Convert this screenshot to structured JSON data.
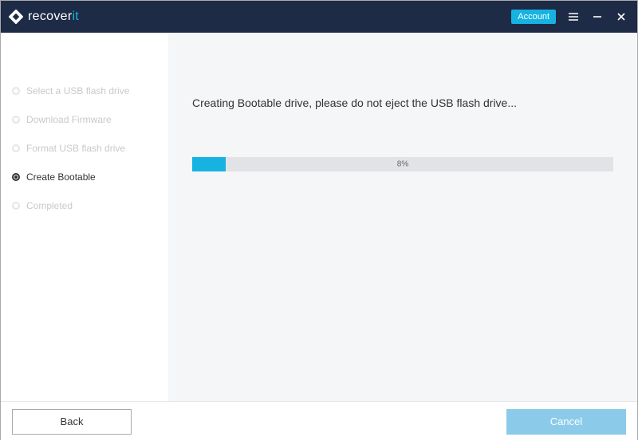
{
  "header": {
    "brand_prefix": "recover",
    "brand_accent": "it",
    "account_label": "Account"
  },
  "sidebar": {
    "steps": [
      {
        "label": "Select a USB flash drive",
        "active": false
      },
      {
        "label": "Download Firmware",
        "active": false
      },
      {
        "label": "Format USB flash drive",
        "active": false
      },
      {
        "label": "Create Bootable",
        "active": true
      },
      {
        "label": "Completed",
        "active": false
      }
    ]
  },
  "main": {
    "status": "Creating Bootable drive, please do not eject the USB flash drive...",
    "progress_percent": 8,
    "progress_label": "8%"
  },
  "footer": {
    "back_label": "Back",
    "cancel_label": "Cancel"
  }
}
